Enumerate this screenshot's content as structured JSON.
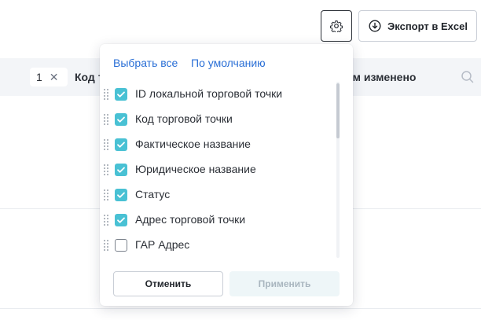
{
  "toolbar": {
    "export_label": "Экспорт в Excel",
    "export_icon": "download-circle-icon",
    "settings_icon": "gear-icon"
  },
  "table": {
    "chip_value": "1",
    "col_left_title": "Код т",
    "col_right_title": "ем изменено"
  },
  "popup": {
    "select_all": "Выбрать все",
    "default": "По умолчанию",
    "items": [
      {
        "label": "ID локальной торговой точки",
        "checked": true
      },
      {
        "label": "Код торговой точки",
        "checked": true
      },
      {
        "label": "Фактическое название",
        "checked": true
      },
      {
        "label": "Юридическое название",
        "checked": true
      },
      {
        "label": "Статус",
        "checked": true
      },
      {
        "label": "Адрес торговой точки",
        "checked": true
      },
      {
        "label": "ГАР Адрес",
        "checked": false
      }
    ],
    "cancel_label": "Отменить",
    "apply_label": "Применить"
  },
  "colors": {
    "accent_link": "#2a6fd6",
    "checkbox_checked": "#49c1d4",
    "apply_disabled_bg": "#eef6f8"
  }
}
